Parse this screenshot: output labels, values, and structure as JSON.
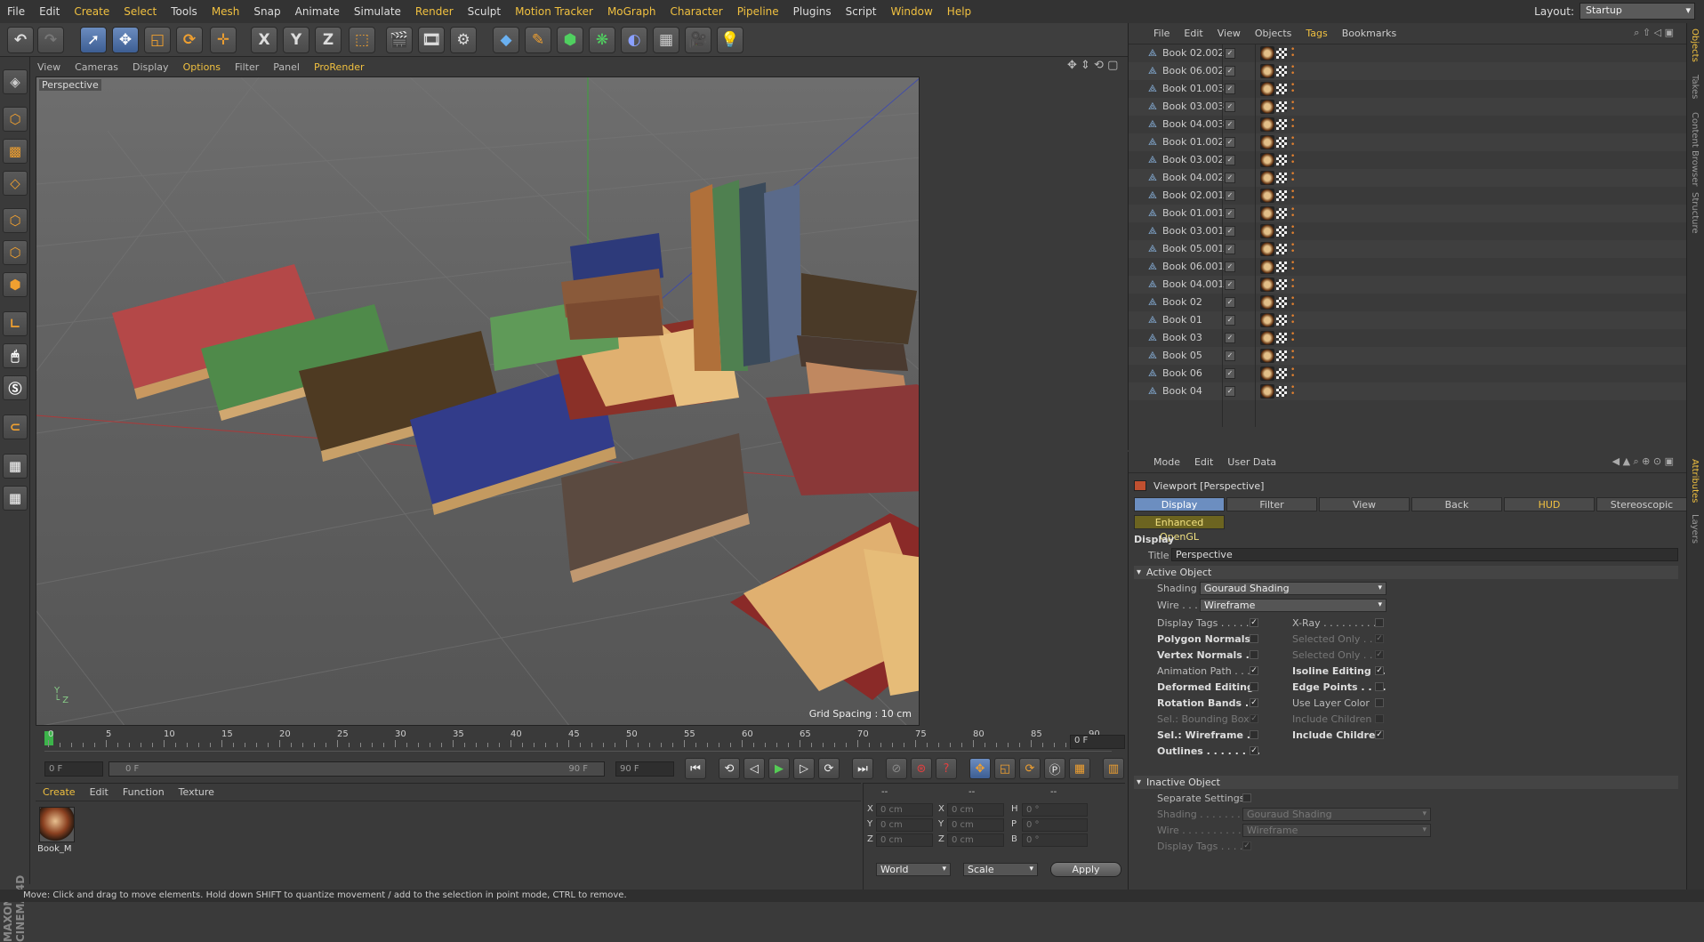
{
  "menubar": {
    "items": [
      "File",
      "Edit",
      "Create",
      "Select",
      "Tools",
      "Mesh",
      "Snap",
      "Animate",
      "Simulate",
      "Render",
      "Sculpt",
      "Motion Tracker",
      "MoGraph",
      "Character",
      "Pipeline",
      "Plugins",
      "Script",
      "Window",
      "Help"
    ],
    "layout_label": "Layout:",
    "layout_value": "Startup"
  },
  "toolbar": {
    "axes": [
      "X",
      "Y",
      "Z"
    ]
  },
  "viewport": {
    "menu": [
      "View",
      "Cameras",
      "Display",
      "Options",
      "Filter",
      "Panel",
      "ProRender"
    ],
    "label": "Perspective",
    "grid_spacing": "Grid Spacing : 10 cm"
  },
  "timeline": {
    "ticks": [
      "0",
      "5",
      "10",
      "15",
      "20",
      "25",
      "30",
      "35",
      "40",
      "45",
      "50",
      "55",
      "60",
      "65",
      "70",
      "75",
      "80",
      "85",
      "90"
    ],
    "current_frame": "0 F",
    "start_field": "0 F",
    "range_start": "0 F",
    "range_end": "90 F",
    "end_field": "90 F"
  },
  "material_manager": {
    "menu": [
      "Create",
      "Edit",
      "Function",
      "Texture"
    ],
    "material_name": "Book_M"
  },
  "coordinates": {
    "header": [
      "--",
      "--",
      "--"
    ],
    "rows": [
      {
        "a": "X",
        "av": "0 cm",
        "b": "X",
        "bv": "0 cm",
        "c": "H",
        "cv": "0 °"
      },
      {
        "a": "Y",
        "av": "0 cm",
        "b": "Y",
        "bv": "0 cm",
        "c": "P",
        "cv": "0 °"
      },
      {
        "a": "Z",
        "av": "0 cm",
        "b": "Z",
        "bv": "0 cm",
        "c": "B",
        "cv": "0 °"
      }
    ],
    "mode1": "World",
    "mode2": "Scale",
    "apply": "Apply"
  },
  "object_manager": {
    "menu": [
      "File",
      "Edit",
      "View",
      "Objects",
      "Tags",
      "Bookmarks"
    ],
    "objects": [
      "Book 02.002",
      "Book 06.002",
      "Book 01.003",
      "Book 03.003",
      "Book 04.003",
      "Book 01.002",
      "Book 03.002",
      "Book 04.002",
      "Book 02.001",
      "Book 01.001",
      "Book 03.001",
      "Book 05.001",
      "Book 06.001",
      "Book 04.001",
      "Book 02",
      "Book 01",
      "Book 03",
      "Book 05",
      "Book 06",
      "Book 04"
    ]
  },
  "attribute_manager": {
    "menu": [
      "Mode",
      "Edit",
      "User Data"
    ],
    "title": "Viewport [Perspective]",
    "tabs": [
      "Display",
      "Filter",
      "View",
      "Back",
      "HUD",
      "Stereoscopic"
    ],
    "subtab": "Enhanced OpenGL",
    "section_display": "Display",
    "title_label": "Title",
    "title_value": "Perspective",
    "active_object": "Active Object",
    "shading_label": "Shading",
    "shading_value": "Gouraud Shading",
    "wire_label": "Wire . . .",
    "wire_value": "Wireframe",
    "left_opts": [
      {
        "label": "Display Tags . . . . .",
        "checked": "✓",
        "style": ""
      },
      {
        "label": "Polygon Normals",
        "checked": "",
        "style": "b"
      },
      {
        "label": "Vertex Normals . .",
        "checked": "",
        "style": "b"
      },
      {
        "label": "Animation Path . . .",
        "checked": "✓",
        "style": ""
      },
      {
        "label": "Deformed Editing",
        "checked": "",
        "style": "b"
      },
      {
        "label": "Rotation Bands . .",
        "checked": "✓",
        "style": "b"
      },
      {
        "label": "Sel.: Bounding Box",
        "checked": "✓",
        "style": "dim"
      },
      {
        "label": "Sel.: Wireframe . .",
        "checked": "",
        "style": "b"
      },
      {
        "label": "Outlines . . . . . . . .",
        "checked": "✓",
        "style": "b"
      }
    ],
    "right_opts": [
      {
        "label": "X-Ray . . . . . . . . . .",
        "checked": "",
        "style": ""
      },
      {
        "label": "Selected Only . .",
        "checked": "✓",
        "style": "dim"
      },
      {
        "label": "Selected Only . .",
        "checked": "✓",
        "style": "dim"
      },
      {
        "label": "Isoline Editing . .",
        "checked": "✓",
        "style": "b"
      },
      {
        "label": "Edge Points . . . .",
        "checked": "",
        "style": "b"
      },
      {
        "label": "Use Layer Color",
        "checked": "",
        "style": ""
      },
      {
        "label": "Include Children",
        "checked": "",
        "style": "dim"
      },
      {
        "label": "Include Children",
        "checked": "✓",
        "style": "b"
      }
    ],
    "inactive_object": "Inactive Object",
    "separate_settings": "Separate Settings",
    "in_shading_label": "Shading . . . . . . . . .",
    "in_shading_value": "Gouraud Shading",
    "in_wire_label": "Wire . . . . . . . . . . . .",
    "in_wire_value": "Wireframe",
    "in_display_tags": "Display Tags . . . . .",
    "in_display_tags_checked": "✓"
  },
  "right_tabs": [
    "Objects",
    "Takes",
    "Content Browser",
    "Structure",
    "Attributes",
    "Layers"
  ],
  "status_bar": "Move: Click and drag to move elements. Hold down SHIFT to quantize movement / add to the selection in point mode, CTRL to remove.",
  "logo": "MAXON CINEMA 4D"
}
